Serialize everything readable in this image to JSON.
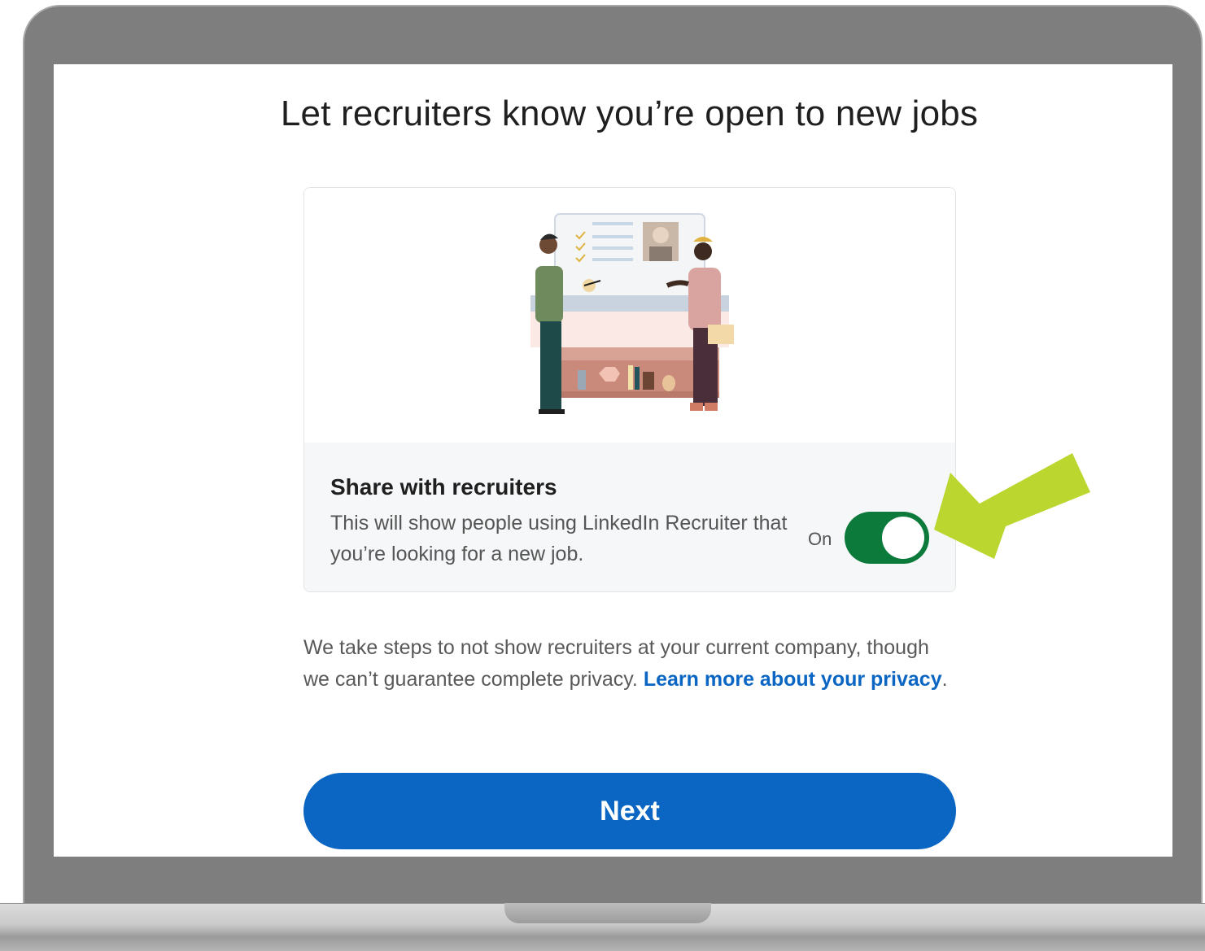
{
  "page": {
    "title": "Let recruiters know you’re open to new jobs"
  },
  "share_card": {
    "title": "Share with recruiters",
    "description": "This will show people using LinkedIn Recruiter that you’re looking for a new job.",
    "toggle_label": "On",
    "toggle_on": true
  },
  "privacy": {
    "text": "We take steps to not show recruiters at your current company, though we can’t guarantee complete privacy.",
    "link_label": "Learn more about your privacy",
    "trailing": "."
  },
  "next_button": {
    "label": "Next"
  },
  "colors": {
    "toggle_on": "#0b7a3b",
    "primary_button": "#0a66c2",
    "link": "#0a66c2",
    "annotation_arrow": "#bcd630"
  },
  "icons": [
    "recruiters-illustration",
    "annotation-arrow-icon"
  ]
}
